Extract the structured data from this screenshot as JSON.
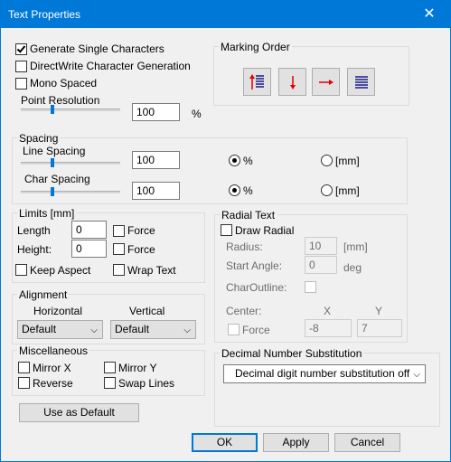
{
  "window": {
    "title": "Text Properties",
    "close_glyph": "✕"
  },
  "general": {
    "gen_single": "Generate Single Characters",
    "directwrite": "DirectWrite Character Generation",
    "mono": "Mono Spaced",
    "point_res_label": "Point Resolution",
    "point_res_value": "100",
    "point_res_unit": "%",
    "point_res_slider": 0.3
  },
  "marking_order": {
    "label": "Marking Order",
    "buttons": [
      "bottom-to-top-lines-icon",
      "arrow-down-icon",
      "arrow-right-icon",
      "horizontal-lines-icon"
    ],
    "colors": {
      "red": "#e00000",
      "navy": "#1a1a8a"
    }
  },
  "spacing": {
    "label": "Spacing",
    "line_label": "Line Spacing",
    "line_value": "100",
    "line_slider": 0.3,
    "char_label": "Char Spacing",
    "char_value": "100",
    "char_slider": 0.3,
    "pct": "%",
    "mm": "[mm]"
  },
  "limits": {
    "label": "Limits [mm]",
    "length_label": "Length",
    "length_value": "0",
    "height_label": "Height:",
    "height_value": "0",
    "force": "Force",
    "keep_aspect": "Keep Aspect",
    "wrap_text": "Wrap Text"
  },
  "alignment": {
    "label": "Alignment",
    "horizontal_label": "Horizontal",
    "vertical_label": "Vertical",
    "horizontal_value": "Default",
    "vertical_value": "Default"
  },
  "misc": {
    "label": "Miscellaneous",
    "mirror_x": "Mirror  X",
    "mirror_y": "Mirror  Y",
    "reverse": "Reverse",
    "swap_lines": "Swap Lines"
  },
  "radial": {
    "label": "Radial Text",
    "draw_radial": "Draw Radial",
    "radius_label": "Radius:",
    "radius_value": "10",
    "radius_unit": "[mm]",
    "start_angle_label": "Start Angle:",
    "start_angle_value": "0",
    "start_angle_unit": "deg",
    "char_outline": "CharOutline:",
    "center_label": "Center:",
    "x_label": "X",
    "y_label": "Y",
    "force": "Force",
    "center_x": "-8",
    "center_y": "7"
  },
  "decimal": {
    "label": "Decimal Number Substitution",
    "value": "Decimal digit number substitution off"
  },
  "buttons": {
    "use_default": "Use as Default",
    "ok": "OK",
    "apply": "Apply",
    "cancel": "Cancel"
  }
}
